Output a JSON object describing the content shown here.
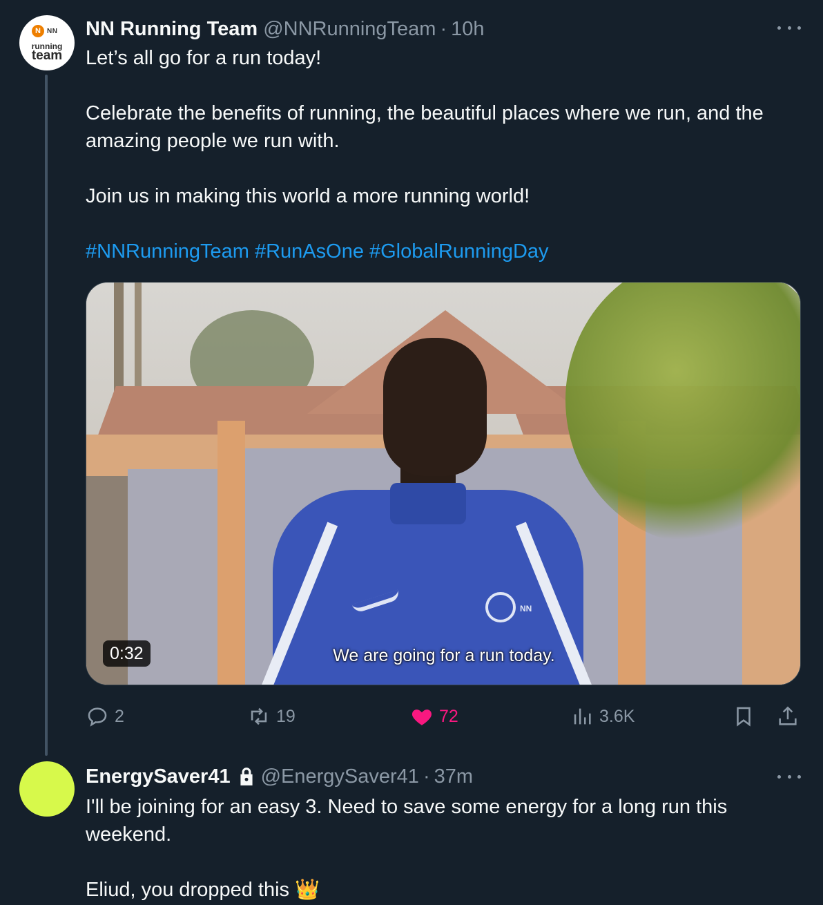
{
  "tweet1": {
    "name": "NN Running Team",
    "handle": "@NNRunningTeam",
    "dot": "·",
    "time": "10h",
    "avatar": {
      "logo_mark": "N",
      "logo_text": "NN",
      "line1": "running",
      "line2": "team"
    },
    "paragraphs": [
      "Let’s all go for a run today!",
      "Celebrate the benefits of running, the beautiful places where we run, and the amazing people we run with.",
      "Join us in making this world a more running world!"
    ],
    "hashtags": [
      "#NNRunningTeam",
      "#RunAsOne",
      "#GlobalRunningDay"
    ],
    "video": {
      "duration": "0:32",
      "subtitle": "We are going for a run today.",
      "jacket_logo_text": "NN"
    },
    "actions": {
      "replies": "2",
      "retweets": "19",
      "likes": "72",
      "views": "3.6K"
    }
  },
  "tweet2": {
    "name": "EnergySaver41",
    "handle": "@EnergySaver41",
    "dot": "·",
    "time": "37m",
    "paragraphs": [
      "I'll be joining for an easy 3. Need to save some energy for a long run this weekend.",
      "Eliud, you dropped this"
    ],
    "emoji": "👑",
    "avatar_color": "#d7f94b"
  },
  "colors": {
    "background": "#15202b",
    "link": "#1d9bf0",
    "like": "#f91880",
    "muted": "#8b98a5"
  }
}
